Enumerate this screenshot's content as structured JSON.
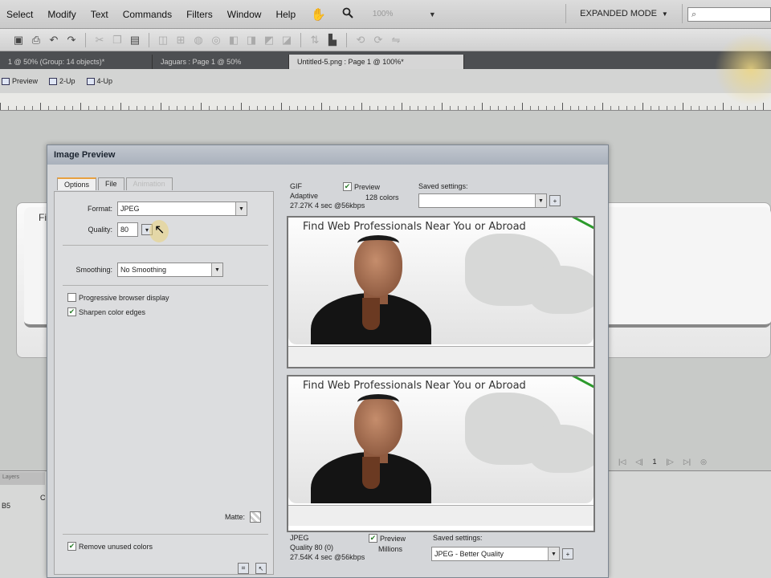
{
  "menu": {
    "items": [
      "Select",
      "Modify",
      "Text",
      "Commands",
      "Filters",
      "Window",
      "Help"
    ],
    "hand_icon": "hand-icon",
    "zoom_icon": "magnifier-icon",
    "zoom_value": "100%",
    "mode": "EXPANDED MODE",
    "mode_arrow": "▼",
    "search_glyph": "⌕"
  },
  "doc_tabs": [
    {
      "label": "1 @ 50% (Group: 14 objects)*",
      "active": false
    },
    {
      "label": "Jaguars : Page 1 @ 50%",
      "active": false
    },
    {
      "label": "Untitled-5.png : Page 1 @ 100%*",
      "active": true
    }
  ],
  "view_bar": {
    "preview": "Preview",
    "two_up": "2-Up",
    "four_up": "4-Up"
  },
  "canvas": {
    "partial_text": "Fi"
  },
  "pager": {
    "page": "1"
  },
  "bottom_panel": {
    "tab_label": "Layers",
    "row_label": "B5",
    "col_label": "C"
  },
  "dialog": {
    "title": "Image Preview",
    "tabs": [
      {
        "label": "Options",
        "state": "active"
      },
      {
        "label": "File",
        "state": "normal"
      },
      {
        "label": "Animation",
        "state": "disabled"
      }
    ],
    "options": {
      "format_label": "Format:",
      "format_value": "JPEG",
      "quality_label": "Quality:",
      "quality_value": "80",
      "smoothing_label": "Smoothing:",
      "smoothing_value": "No Smoothing",
      "progressive_label": "Progressive browser display",
      "progressive_checked": false,
      "sharpen_label": "Sharpen color edges",
      "sharpen_checked": true,
      "matte_label": "Matte:",
      "remove_unused_label": "Remove unused colors",
      "remove_unused_checked": true
    },
    "top_preview": {
      "format": "GIF",
      "palette": "Adaptive",
      "size_time": "27.27K  4 sec @56kbps",
      "preview_label": "Preview",
      "colors": "128 colors",
      "saved_settings_label": "Saved settings:",
      "saved_settings_value": "",
      "heading": "Find Web Professionals Near You or Abroad"
    },
    "bottom_preview": {
      "format": "JPEG",
      "quality": "Quality 80 (0)",
      "size_time": "27.54K  4 sec @56kbps",
      "preview_label": "Preview",
      "colors": "Millions",
      "saved_settings_label": "Saved settings:",
      "saved_settings_value": "JPEG - Better Quality",
      "heading": "Find Web Professionals Near You or Abroad"
    }
  }
}
